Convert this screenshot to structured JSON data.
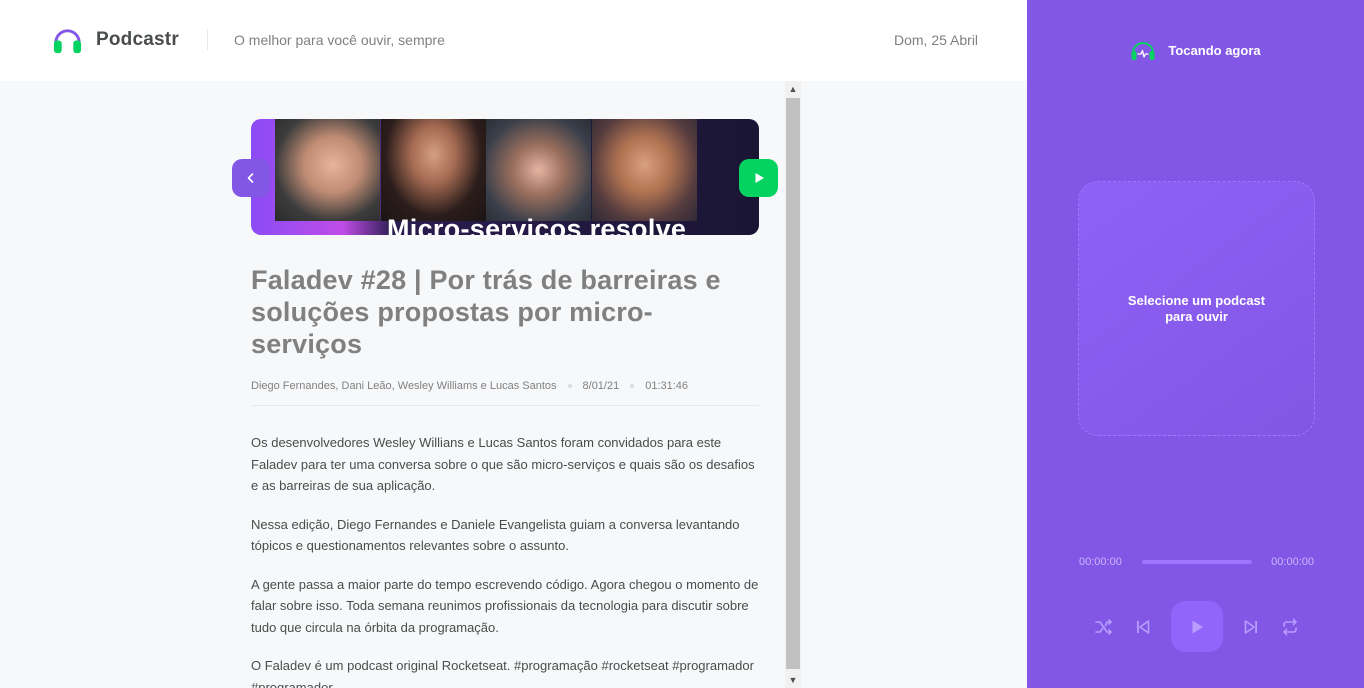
{
  "header": {
    "app_name": "Podcastr",
    "tagline": "O melhor para você ouvir, sempre",
    "date": "Dom, 25 Abril"
  },
  "episode": {
    "thumbnail_caption": "Micro-serviços resolve",
    "title": "Faladev #28 | Por trás de barreiras e soluções propostas por micro-serviços",
    "members": "Diego Fernandes, Dani Leão, Wesley Williams e Lucas Santos",
    "published_at": "8/01/21",
    "duration": "01:31:46",
    "description": [
      "Os desenvolvedores Wesley Willians e Lucas Santos foram convidados para este Faladev para ter uma conversa sobre o que são micro-serviços e quais são os desafios e as barreiras de sua aplicação.",
      "Nessa edição, Diego Fernandes e Daniele Evangelista guiam a conversa levantando tópicos e questionamentos relevantes sobre o assunto.",
      "A gente passa a maior parte do tempo escrevendo código. Agora chegou o momento de falar sobre isso. Toda semana reunimos profissionais da tecnologia para discutir sobre tudo que circula na órbita da programação.",
      "O Faladev é um podcast original Rocketseat. #programação #rocketseat #programador #programador"
    ]
  },
  "player": {
    "heading": "Tocando agora",
    "empty_message": "Selecione um podcast para ouvir",
    "current_time": "00:00:00",
    "total_time": "00:00:00",
    "progress": 0
  },
  "icons": {
    "logo": "headphones-icon",
    "back": "chevron-left-icon",
    "play_episode": "play-icon",
    "now_playing": "headphones-playing-icon",
    "shuffle": "shuffle-icon",
    "previous": "skip-previous-icon",
    "play": "play-icon",
    "next": "skip-next-icon",
    "repeat": "repeat-icon"
  },
  "colors": {
    "brand_purple": "#8257e5",
    "accent_green": "#04d361",
    "text_gray": "#808080",
    "text_dark": "#494d4b"
  }
}
